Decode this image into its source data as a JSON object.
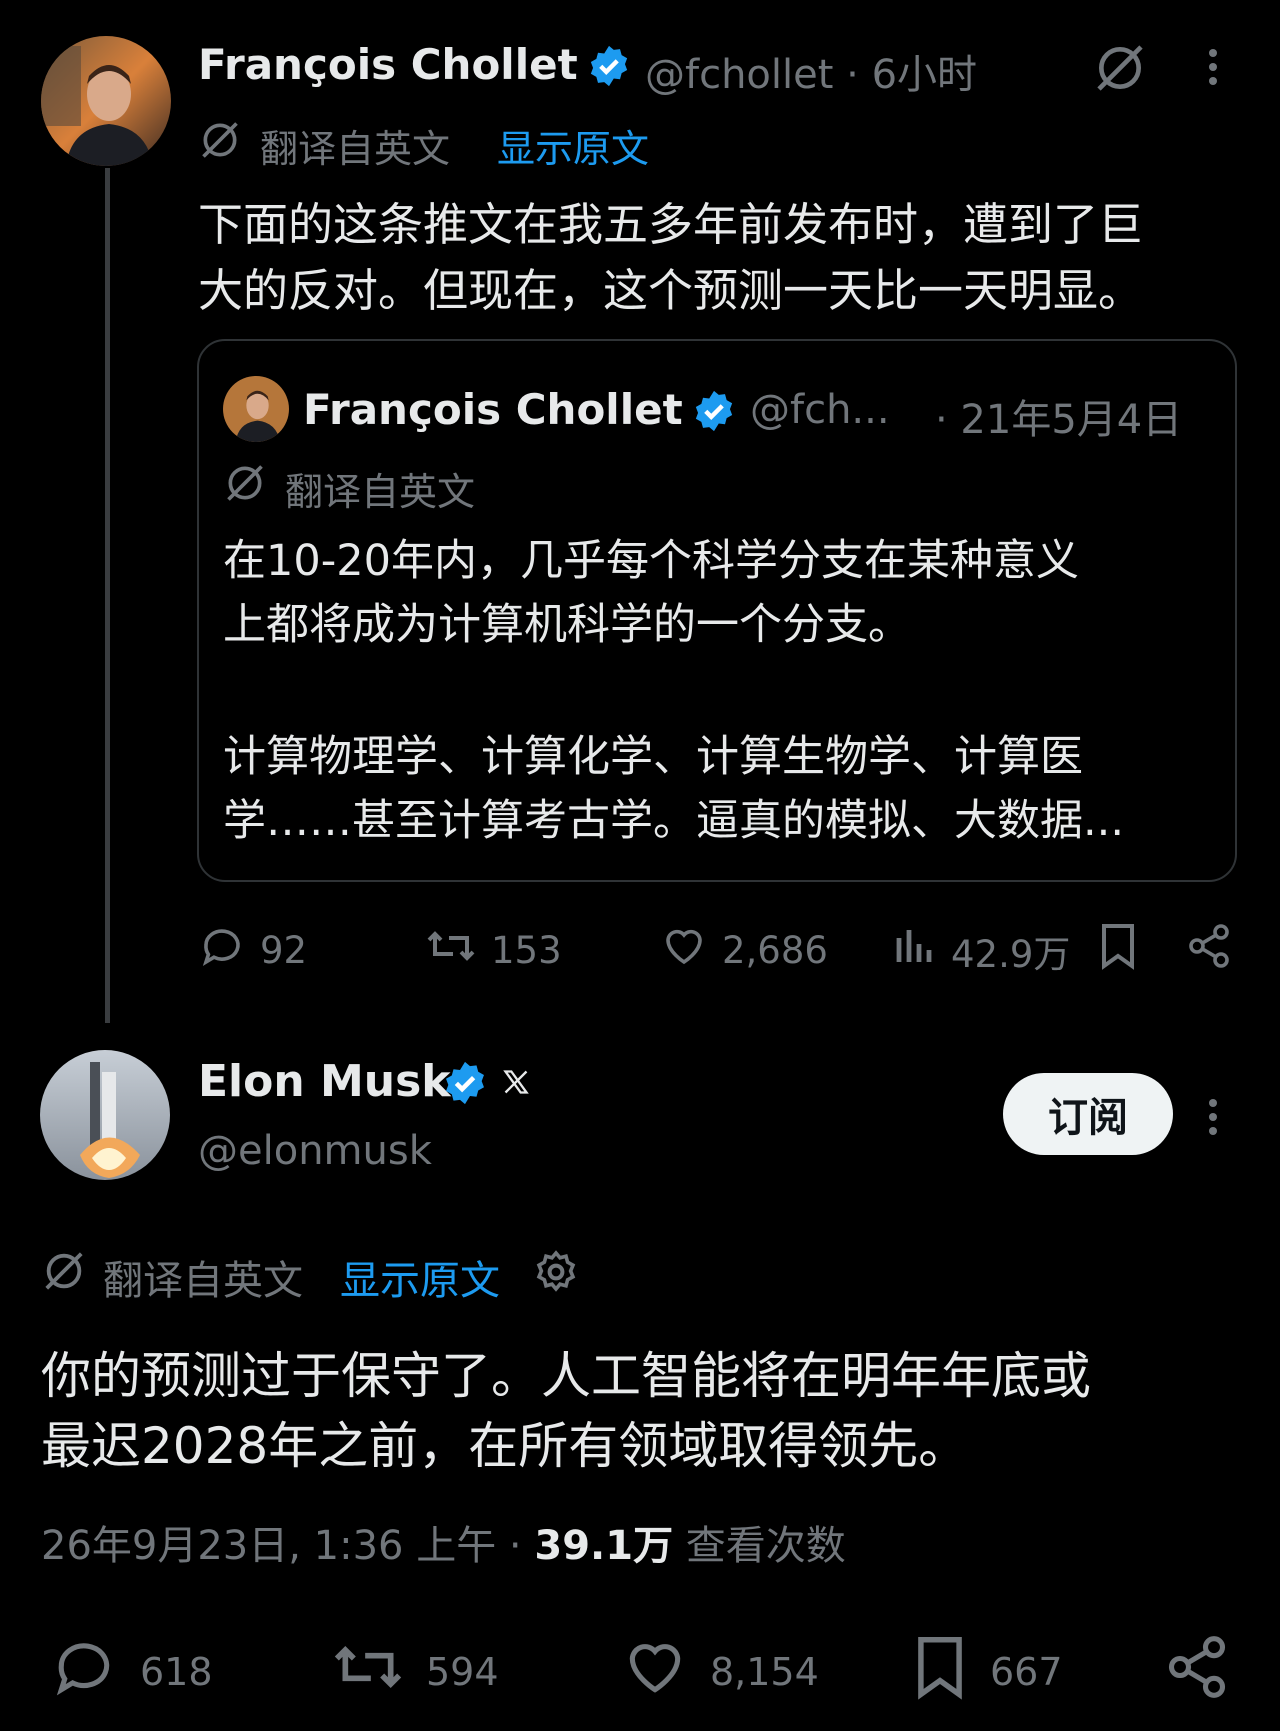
{
  "tweet1": {
    "author_name": "François Chollet",
    "handle_time": "@fchollet · 6小时",
    "translated_label": "翻译自英文",
    "show_original": "显示原文",
    "text_line1": "下面的这条推文在我五多年前发布时，遭到了巨",
    "text_line2": "大的反对。但现在，这个预测一天比一天明显。",
    "actions": {
      "replies": "92",
      "retweets": "153",
      "likes": "2,686",
      "views": "42.9万"
    }
  },
  "quoted": {
    "author_name": "François Chollet",
    "handle": "@fch...",
    "date": "· 21年5月4日",
    "translated_label": "翻译自英文",
    "para1_line1": "在10-20年内，几乎每个科学分支在某种意义",
    "para1_line2": "上都将成为计算机科学的一个分支。",
    "para2_line1": "计算物理学、计算化学、计算生物学、计算医",
    "para2_line2": "学……甚至计算考古学。逼真的模拟、大数据..."
  },
  "tweet2": {
    "author_name": "Elon Musk",
    "handle": "@elonmusk",
    "subscribe_label": "订阅",
    "translated_label": "翻译自英文",
    "show_original": "显示原文",
    "text_line1": "你的预测过于保守了。人工智能将在明年年底或",
    "text_line2": "最迟2028年之前，在所有领域取得领先。",
    "timestamp": "26年9月23日, 1:36 上午 ·",
    "views_count": "39.1万",
    "views_label": "查看次数",
    "actions": {
      "replies": "618",
      "retweets": "594",
      "likes": "8,154",
      "bookmarks": "667"
    }
  },
  "colors": {
    "background": "#000000",
    "text": "#e7e9ea",
    "muted": "#71767b",
    "link": "#1d9bf0",
    "verified": "#1d9bf0"
  },
  "icons": [
    "translate-icon",
    "verified-badge-icon",
    "grok-icon",
    "more-icon",
    "reply-icon",
    "retweet-icon",
    "like-icon",
    "views-icon",
    "bookmark-icon",
    "share-icon",
    "gear-icon",
    "x-logo-icon"
  ]
}
